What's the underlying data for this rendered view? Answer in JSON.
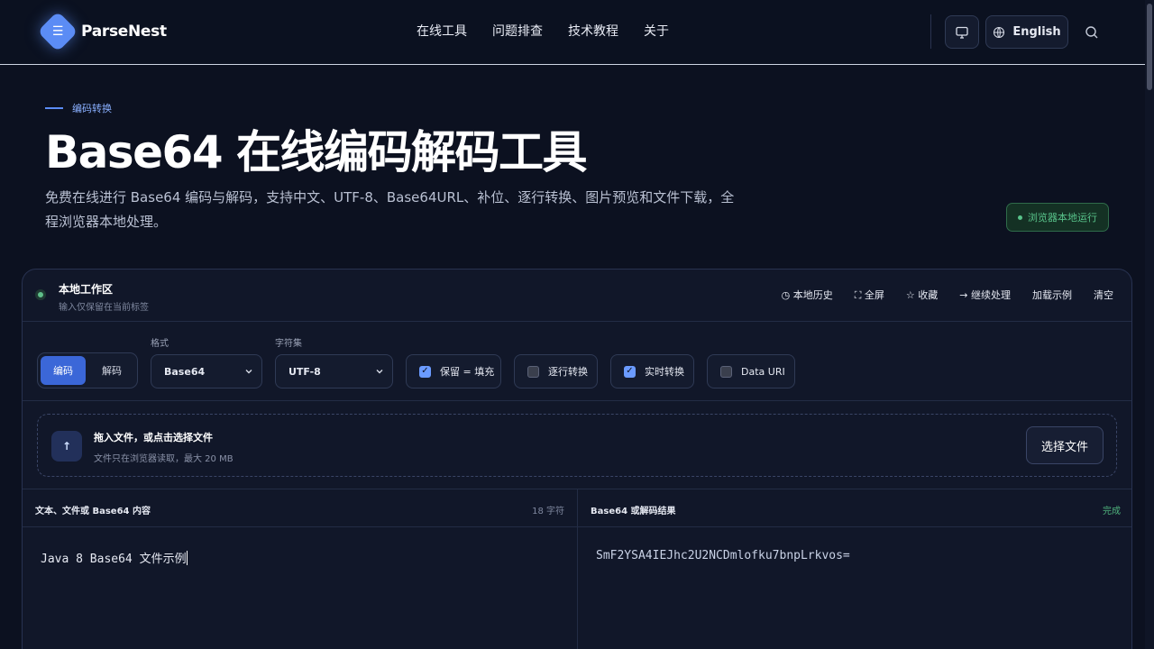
{
  "header": {
    "logo_text": "ParseNest",
    "logo_glyph": "☰",
    "nav": [
      "在线工具",
      "问题排查",
      "技术教程",
      "关于"
    ],
    "language_label": "English"
  },
  "hero": {
    "eyebrow": "编码转换",
    "title": "Base64 在线编码解码工具",
    "description": "免费在线进行 Base64 编码与解码，支持中文、UTF-8、Base64URL、补位、逐行转换、图片预览和文件下载，全程浏览器本地处理。",
    "badge": "浏览器本地运行"
  },
  "workspace": {
    "title": "本地工作区",
    "subtitle": "输入仅保留在当前标签",
    "actions": [
      "◷ 本地历史",
      "⛶ 全屏",
      "☆ 收藏",
      "→ 继续处理",
      "加载示例",
      "清空"
    ]
  },
  "controls": {
    "mode_encode": "编码",
    "mode_decode": "解码",
    "mode_selected": "编码",
    "format_label": "格式",
    "format_value": "Base64",
    "charset_label": "字符集",
    "charset_value": "UTF-8",
    "options": [
      {
        "label": "保留 = 填充",
        "checked": true
      },
      {
        "label": "逐行转换",
        "checked": false
      },
      {
        "label": "实时转换",
        "checked": true
      },
      {
        "label": "Data URI",
        "checked": false
      }
    ]
  },
  "dropzone": {
    "title": "拖入文件，或点击选择文件",
    "subtitle": "文件只在浏览器读取，最大 20 MB",
    "button": "选择文件",
    "icon": "↑"
  },
  "input_pane": {
    "title": "文本、文件或 Base64 内容",
    "meta": "18 字符",
    "content": "Java 8 Base64 文件示例"
  },
  "output_pane": {
    "title": "Base64 或解码结果",
    "meta": "完成",
    "content": "SmF2YSA4IEJhc2U2NCDmlofku7bnpLrkvos="
  },
  "colors": {
    "accent": "#5b8cf5",
    "success": "#58c38a",
    "background": "#0c1120"
  }
}
